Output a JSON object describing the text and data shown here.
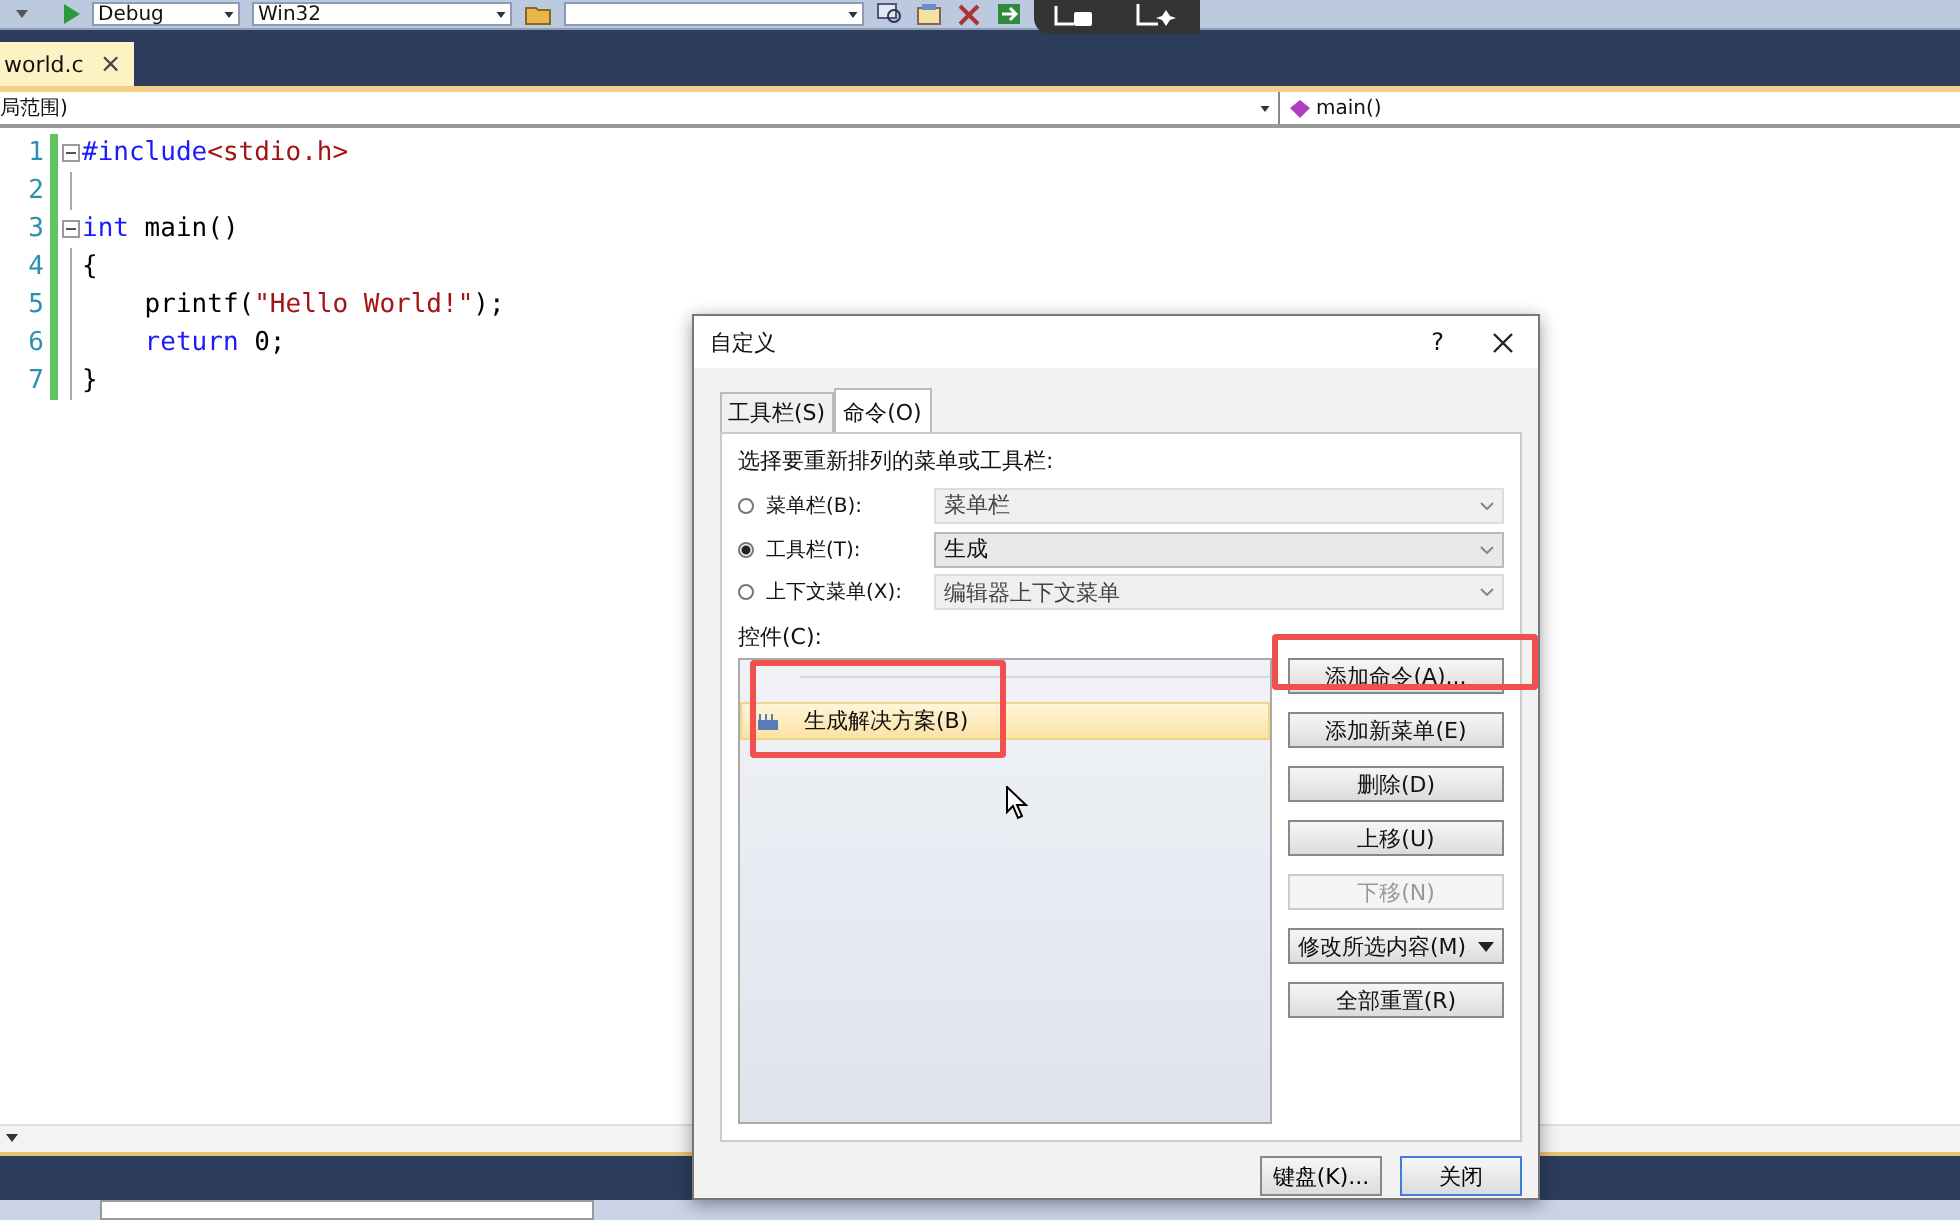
{
  "toolbar": {
    "configuration": "Debug",
    "platform": "Win32"
  },
  "editor_tab": {
    "title": "world.c",
    "close": "×"
  },
  "navigation": {
    "scope": "局范围)",
    "member": "main()"
  },
  "code_lines": [
    {
      "number": "1",
      "foldable": true,
      "tokens": [
        {
          "kind": "keyword",
          "text": "#include"
        },
        {
          "kind": "string",
          "text": "<stdio.h>"
        }
      ]
    },
    {
      "number": "2",
      "foldable": false
    },
    {
      "number": "3",
      "foldable": true,
      "tokens": [
        {
          "kind": "keyword",
          "text": "int"
        },
        {
          "kind": "plain",
          "text": " main()"
        }
      ]
    },
    {
      "number": "4",
      "foldable": false,
      "tokens": [
        {
          "kind": "plain",
          "text": "{"
        }
      ]
    },
    {
      "number": "5",
      "foldable": false,
      "tokens": [
        {
          "kind": "plain",
          "text": "    printf("
        },
        {
          "kind": "string",
          "text": "\"Hello World!\""
        },
        {
          "kind": "plain",
          "text": ");"
        }
      ]
    },
    {
      "number": "6",
      "foldable": false,
      "tokens": [
        {
          "kind": "keyword",
          "text": "    return"
        },
        {
          "kind": "plain",
          "text": " 0;"
        }
      ]
    },
    {
      "number": "7",
      "foldable": false,
      "tokens": [
        {
          "kind": "plain",
          "text": "}"
        }
      ]
    }
  ],
  "dialog": {
    "title": "自定义",
    "help": "?",
    "tabs": [
      {
        "label": "工具栏(S)",
        "selected": false
      },
      {
        "label": "命令(O)",
        "selected": true
      }
    ],
    "prompt": "选择要重新排列的菜单或工具栏:",
    "targets": [
      {
        "label": "菜单栏(B):",
        "value": "菜单栏",
        "selected": false
      },
      {
        "label": "工具栏(T):",
        "value": "生成",
        "selected": true
      },
      {
        "label": "上下文菜单(X):",
        "value": "编辑器上下文菜单",
        "selected": false
      }
    ],
    "controls_label": "控件(C):",
    "controls": [
      {
        "label": "生成解决方案(B)",
        "selected": true
      }
    ],
    "buttons": [
      {
        "label": "添加命令(A)...",
        "kind": "plain",
        "disabled": false
      },
      {
        "label": "添加新菜单(E)",
        "kind": "plain",
        "disabled": false
      },
      {
        "label": "删除(D)",
        "kind": "plain",
        "disabled": false
      },
      {
        "label": "上移(U)",
        "kind": "plain",
        "disabled": false
      },
      {
        "label": "下移(N)",
        "kind": "plain",
        "disabled": true
      },
      {
        "label": "修改所选内容(M)",
        "kind": "menu",
        "disabled": false
      },
      {
        "label": "全部重置(R)",
        "kind": "plain",
        "disabled": false
      }
    ],
    "footer_buttons": [
      {
        "label": "键盘(K)...",
        "default": false
      },
      {
        "label": "关闭",
        "default": true
      }
    ]
  }
}
